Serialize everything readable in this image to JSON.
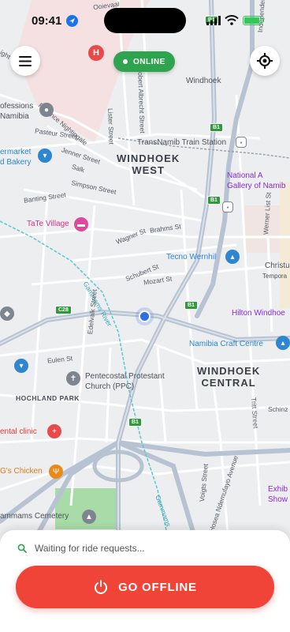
{
  "status_bar": {
    "time": "09:41"
  },
  "header": {
    "online_label": "ONLINE"
  },
  "map": {
    "areas": [
      "WINDHOEK\nWEST",
      "WINDHOEK\nCENTRAL",
      "HOCHLAND PARK"
    ],
    "places": {
      "train_station": "TransNamib Train Station",
      "windhoek": "Windhoek",
      "professions": "ofessions\nNamibia",
      "supermarket": "ermarket\nd Bakery",
      "tate_village": "TaTe Village",
      "tecno": "Tecno Wernhil",
      "national": "National A\nGallery of Namib",
      "hilton": "Hilton Windhoe",
      "craft_centre": "Namibia Craft Centre",
      "church": "Pentecostal Protestant\nChurch (PPC)",
      "dental": "ental clinic",
      "chicken": "G's Chicken",
      "cemetery": "ammams Cemetery",
      "christu": "Christu",
      "tempora": "Tempora",
      "exhib": "Exhib\nShow"
    },
    "streets": {
      "pasteur": "Pasteur Street",
      "jenner": "Jenner Street",
      "salk": "Salk",
      "simpson": "Simpson Street",
      "banting": "Banting Street",
      "florence": "Florence Nightingale",
      "lister": "Lister Street",
      "albrecht": "Robert Albrecht Street",
      "wagner": "Wagner St",
      "brahms": "Brahms St",
      "schubert": "Schubert St",
      "mozart": "Mozart St",
      "gammams": "Gammams River",
      "gammams2": "Gammams",
      "edelvalk": "Edelvalk Street",
      "eulen": "Eulen St",
      "werner": "Werner List St",
      "tritt": "Tritt Street",
      "schinz": "Schinz",
      "voigts": "Voigts Street",
      "ndemufayo": "Hosea Ndemufayo Avenue",
      "independence": "Independence",
      "oojevaar": "Ooievaal",
      "nicht": "ight"
    },
    "shields": [
      "C28",
      "B1",
      "B1",
      "B1",
      "B1",
      "B1"
    ]
  },
  "sheet": {
    "waiting_text": "Waiting for ride requests...",
    "offline_label": "GO OFFLINE"
  },
  "colors": {
    "online": "#2ea44f",
    "offline": "#f04438",
    "user_dot": "#2f6fde"
  }
}
